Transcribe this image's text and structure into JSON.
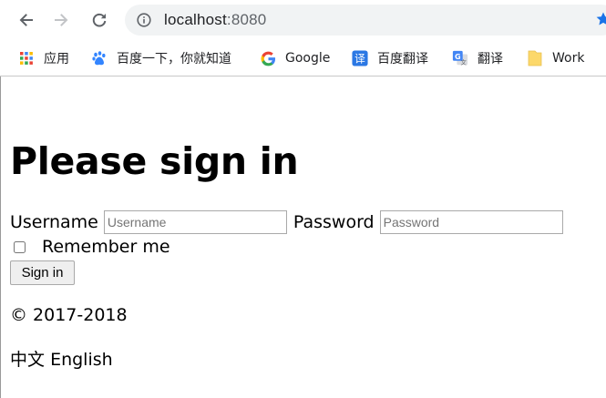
{
  "browser": {
    "url_host": "localhost",
    "url_port": ":8080",
    "icons": {
      "back": "arrow-left-icon",
      "forward": "arrow-right-icon",
      "reload": "reload-icon",
      "info": "info-icon",
      "star": "star-icon"
    }
  },
  "bookmarks": [
    {
      "label": "应用",
      "icon": "apps-grid-icon"
    },
    {
      "label": "百度一下，你就知道",
      "icon": "baidu-paw-icon"
    },
    {
      "label": "Google",
      "icon": "google-g-icon"
    },
    {
      "label": "百度翻译",
      "icon": "translate-badge-icon"
    },
    {
      "label": "翻译",
      "icon": "google-translate-icon"
    },
    {
      "label": "Work",
      "icon": "folder-icon"
    }
  ],
  "page": {
    "heading": "Please sign in",
    "username_label": "Username",
    "username_placeholder": "Username",
    "password_label": "Password",
    "password_placeholder": "Password",
    "remember_label": "Remember me",
    "signin_label": "Sign in",
    "copyright": "© 2017-2018",
    "lang_zh": "中文",
    "lang_en": "English"
  },
  "colors": {
    "omnibox_bg": "#f1f3f4",
    "icon_gray": "#5f6368",
    "star_blue": "#1a73e8",
    "folder_yellow": "#fcd86a"
  }
}
